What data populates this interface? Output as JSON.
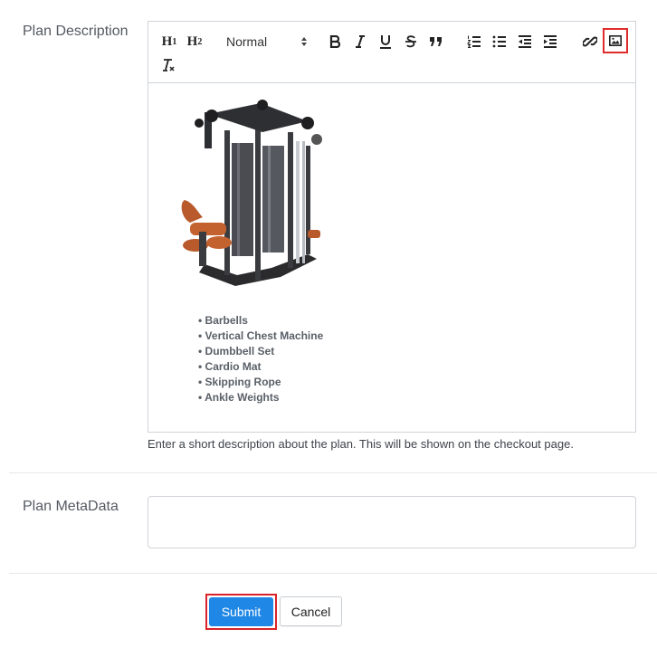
{
  "plan_description": {
    "label": "Plan Description",
    "help_text": "Enter a short description about the plan. This will be shown on the checkout page.",
    "toolbar": {
      "h1": "H",
      "h1_sub": "1",
      "h2": "H",
      "h2_sub": "2",
      "format_select": "Normal",
      "icons": [
        "bold-icon",
        "italic-icon",
        "underline-icon",
        "strikethrough-icon",
        "blockquote-icon",
        "ordered-list-icon",
        "bullet-list-icon",
        "outdent-icon",
        "indent-icon",
        "link-icon",
        "image-icon",
        "clear-format-icon"
      ]
    },
    "content": {
      "image": "gym-machine-image",
      "items": [
        "Barbells",
        "Vertical Chest Machine",
        "Dumbbell Set",
        "Cardio Mat",
        "Skipping Rope",
        "Ankle Weights"
      ]
    }
  },
  "plan_metadata": {
    "label": "Plan MetaData",
    "value": ""
  },
  "actions": {
    "submit_label": "Submit",
    "cancel_label": "Cancel"
  },
  "colors": {
    "accent": "#1f87e5",
    "highlight": "#e02b2b",
    "border": "#cfd3d8"
  }
}
